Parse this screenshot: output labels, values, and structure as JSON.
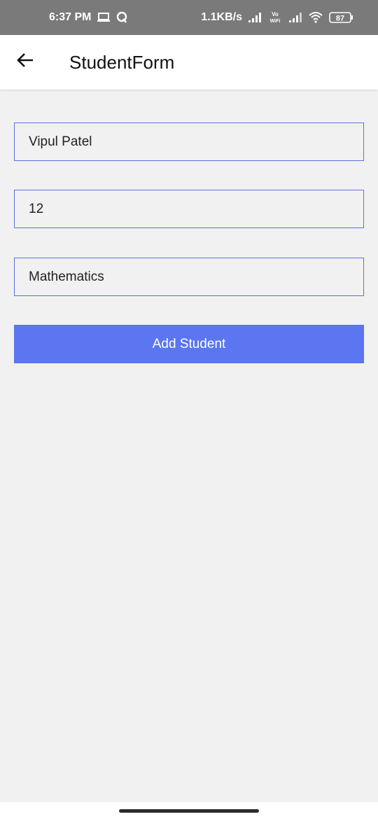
{
  "status_bar": {
    "time": "6:37 PM",
    "network_speed": "1.1KB/s",
    "battery": "87",
    "icons": [
      "laptop-icon",
      "q-icon",
      "signal-icon",
      "vowifi-icon",
      "wifi-icon",
      "battery-icon"
    ],
    "vowifi_top": "Vo",
    "vowifi_bottom": "WiFi"
  },
  "app_bar": {
    "title": "StudentForm",
    "back_icon": "arrow-left-icon"
  },
  "form": {
    "name_value": "Vipul Patel",
    "roll_value": "12",
    "subject_value": "Mathematics",
    "submit_label": "Add Student"
  },
  "colors": {
    "accent": "#5b76f0",
    "field_border": "#5b6fe8",
    "background": "#f1f1f1",
    "status_bar": "#7a7a7a"
  }
}
